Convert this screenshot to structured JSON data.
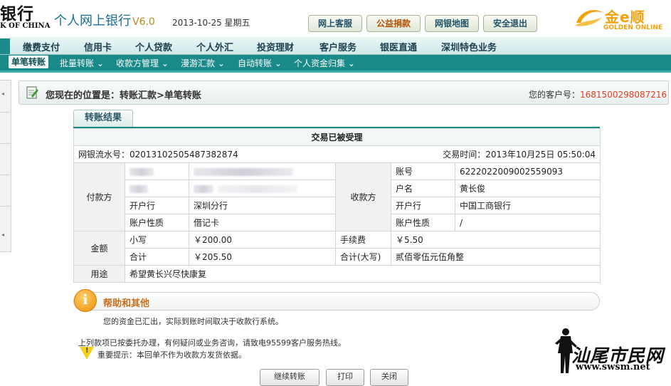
{
  "header": {
    "bank_name_cn": "银行",
    "bank_name_en": "K OF CHINA",
    "system_name": "个人网上银行",
    "version": "V6.0",
    "date": "2013-10-25 星期五",
    "buttons": [
      {
        "label": "网上客服"
      },
      {
        "label": "公益捐款"
      },
      {
        "label": "网银地图"
      },
      {
        "label": "安全退出"
      }
    ],
    "partner_logo": {
      "cn": "金e顺",
      "en": "GOLDEN ONLINE"
    }
  },
  "nav_main": [
    "缴费支付",
    "信用卡",
    "个人贷款",
    "个人外汇",
    "投资理财",
    "客户服务",
    "银医直通",
    "深圳特色业务"
  ],
  "nav_sub": [
    {
      "label": "单笔转账",
      "active": true
    },
    {
      "label": "批量转账 ⌄"
    },
    {
      "label": "收款方管理 ⌄"
    },
    {
      "label": "漫游汇款 ⌄"
    },
    {
      "label": "自动转账 ⌄"
    },
    {
      "label": "个人资金归集 ⌄"
    }
  ],
  "location": {
    "label": "您现在的位置是：转账汇款>单笔转账",
    "customer_label": "您的客户号：",
    "customer_no": "1681500298087216"
  },
  "result": {
    "tab_label": "转账结果",
    "status": "交易已被受理",
    "serial_label": "网银流水号：",
    "serial_no": "02013102505487382874",
    "time_label": "交易时间：",
    "time": "2013年10月25日 05:50:04",
    "payer": {
      "heading": "付款方",
      "bank_label": "开户行",
      "bank": "深圳分行",
      "type_label": "账户性质",
      "type": "借记卡"
    },
    "payee": {
      "heading": "收款方",
      "account_label": "账号",
      "account": "6222022009002559093",
      "name_label": "户名",
      "name": "黄长俊",
      "bank_label": "开户行",
      "bank": "中国工商银行",
      "type_label": "账户性质",
      "type": "/"
    },
    "amount": {
      "heading": "金额",
      "small_label": "小写",
      "small": "￥200.00",
      "fee_label": "手续费",
      "fee": "￥5.50",
      "total_label": "合计",
      "total": "￥205.50",
      "total_cap_label": "合计(大写)",
      "total_cap": "贰佰零伍元伍角整"
    },
    "purpose_label": "用途",
    "purpose": "希望黄长兴尽快康复"
  },
  "help": {
    "title": "帮助和其他",
    "text": "您的资金已汇出，实际到账时间取决于收款行系统。",
    "note1": "上列款项已按委托办理，有何疑问或业务咨询，请致电95599客户服务热线。",
    "note2": "重要提示：本回单不作为收款方发货依据。"
  },
  "bottom_buttons": [
    "继续转账",
    "打印",
    "关闭"
  ],
  "watermark": {
    "cn": "汕尾市民网",
    "url": "www.swsm.net"
  },
  "colors": {
    "teal": "#198a89",
    "accent_orange": "#d4612e",
    "customer_no": "#e0401e"
  }
}
